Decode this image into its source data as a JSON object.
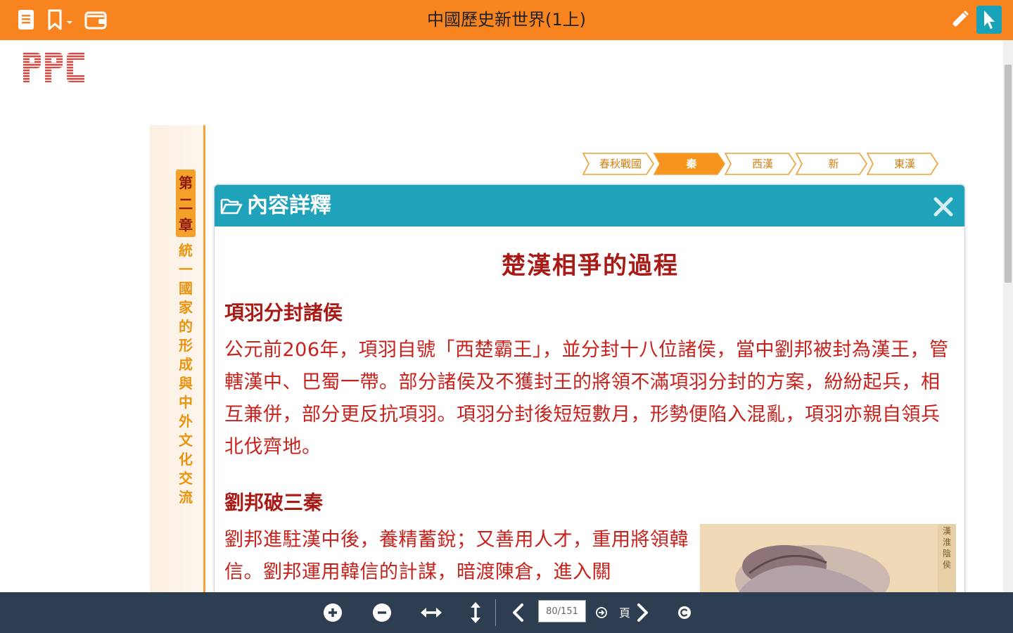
{
  "app": {
    "title": "中國歷史新世界(1上)"
  },
  "toolbar": {
    "left_icons": [
      "book-icon",
      "bookmark-dropdown-icon",
      "wallet-icon"
    ],
    "right_icons": [
      "pencil-icon",
      "cursor-icon"
    ]
  },
  "brand": {
    "logo": "PPC",
    "color": "#e8413a"
  },
  "chapter": {
    "tag": "第二章",
    "title": "統一國家的形成與中外文化交流"
  },
  "timeline": {
    "items": [
      {
        "label": "春秋戰國",
        "active": false
      },
      {
        "label": "秦",
        "active": true
      },
      {
        "label": "西漢",
        "active": false
      },
      {
        "label": "新",
        "active": false
      },
      {
        "label": "東漢",
        "active": false
      }
    ]
  },
  "dialog": {
    "header": "內容詳釋",
    "article_title": "楚漢相爭的過程",
    "sections": [
      {
        "title": "項羽分封諸侯",
        "text": "公元前206年，項羽自號「西楚霸王」，並分封十八位諸侯，當中劉邦被封為漢王，管轄漢中、巴蜀一帶。部分諸侯及不獲封王的將領不滿項羽分封的方案，紛紛起兵，相互兼併，部分更反抗項羽。項羽分封後短短數月，形勢便陷入混亂，項羽亦親自領兵北伐齊地。"
      },
      {
        "title": "劉邦破三秦",
        "text": "劉邦進駐漢中後，養精蓄銳；又善用人才，重用將領韓信。劉邦運用韓信的計謀，暗渡陳倉，進入關"
      }
    ],
    "portrait_caption": "漢淮陰侯"
  },
  "pager": {
    "value": "80/151",
    "unit": "頁"
  },
  "colors": {
    "topbar": "#f7841f",
    "dialog_header": "#1fa3bb",
    "text": "#c8221c",
    "bottombar": "#2e3e51"
  }
}
